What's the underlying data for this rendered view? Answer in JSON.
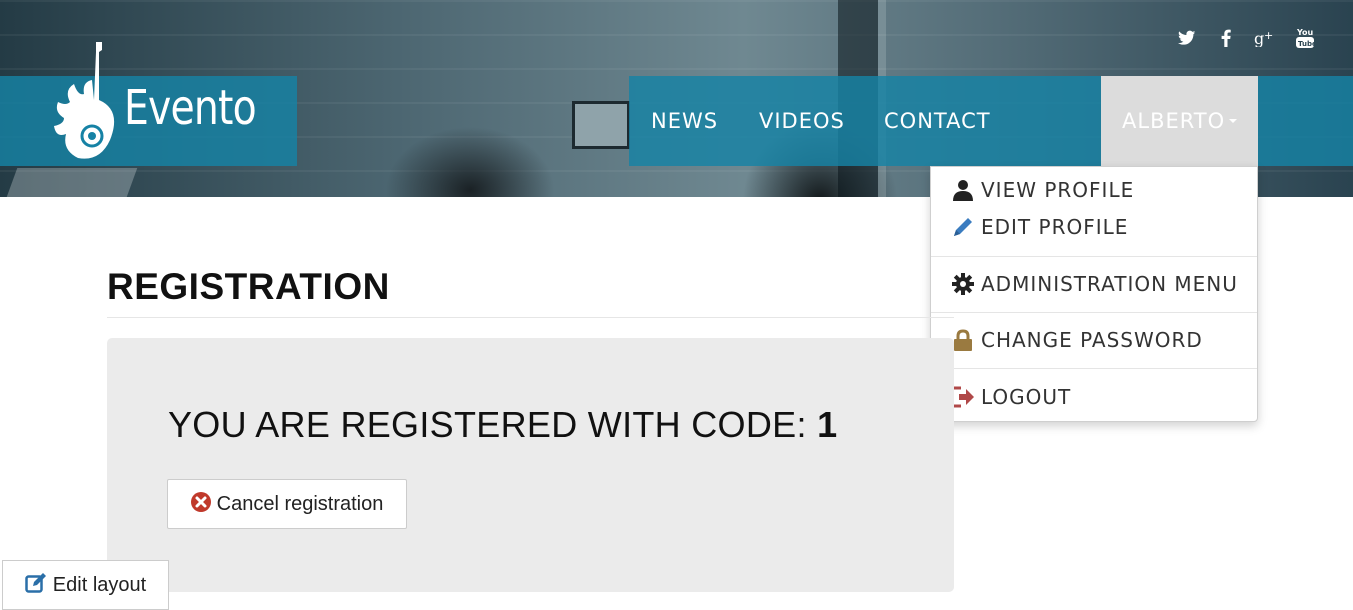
{
  "brand": {
    "name": "Evento"
  },
  "social": [
    {
      "icon": "twitter-icon"
    },
    {
      "icon": "facebook-icon"
    },
    {
      "icon": "google-plus-icon"
    },
    {
      "icon": "youtube-icon"
    }
  ],
  "nav": {
    "links": [
      "NEWS",
      "VIDEOS",
      "CONTACT"
    ],
    "user": "ALBERTO"
  },
  "user_menu": {
    "items": [
      {
        "label": "VIEW PROFILE",
        "icon": "user-icon"
      },
      {
        "label": "EDIT PROFILE",
        "icon": "pencil-icon"
      },
      {
        "label": "ADMINISTRATION MENU",
        "icon": "gear-icon"
      },
      {
        "label": "CHANGE PASSWORD",
        "icon": "lock-icon"
      },
      {
        "label": "LOGOUT",
        "icon": "logout-icon"
      }
    ]
  },
  "main": {
    "title": "REGISTRATION",
    "registered_prefix": "YOU ARE REGISTERED WITH CODE:",
    "registered_code": "1",
    "cancel_label": "Cancel registration"
  },
  "footer": {
    "edit_layout_label": "Edit layout"
  },
  "colors": {
    "nav_bg": "#1682a5",
    "active_user_bg": "#dcdcdc",
    "cancel_icon": "#c0392b",
    "logout_icon": "#b04848",
    "lock_icon": "#9a7a40",
    "pencil_icon": "#3a7cc0",
    "edit_icon": "#2a6fa8"
  }
}
